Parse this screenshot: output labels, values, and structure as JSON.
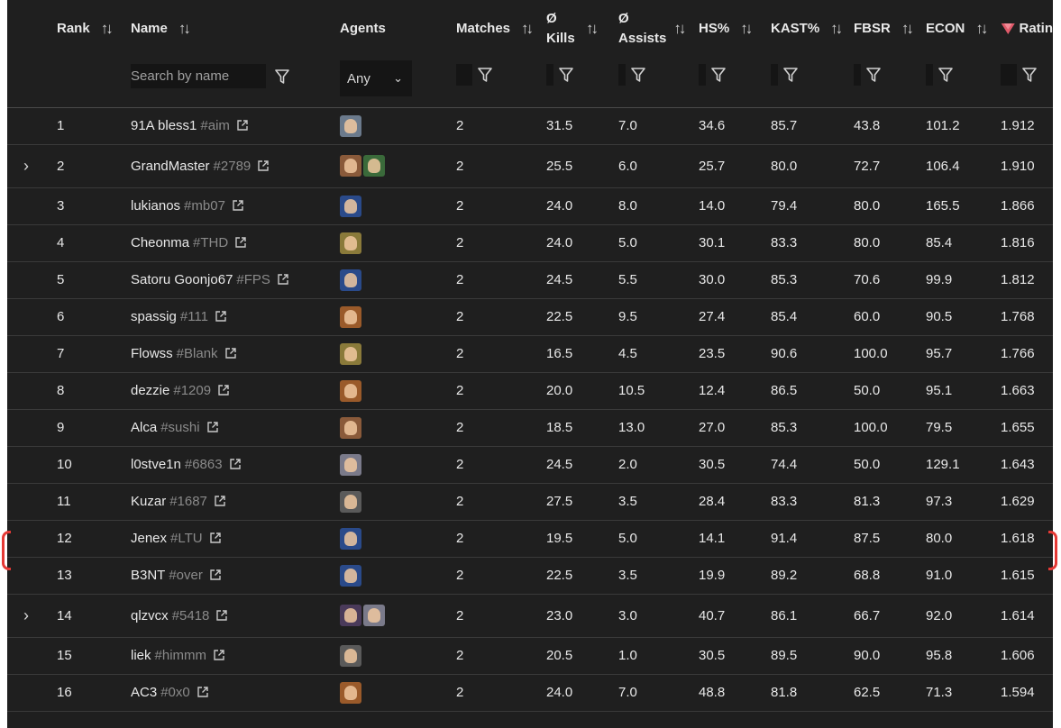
{
  "columns": {
    "rank": "Rank",
    "name": "Name",
    "agents": "Agents",
    "matches": "Matches",
    "kills_symbol": "Ø",
    "kills": "Kills",
    "assists_symbol": "Ø",
    "assists": "Assists",
    "hs": "HS%",
    "kast": "KAST%",
    "fbsr": "FBSR",
    "econ": "ECON",
    "rating": "Ratin"
  },
  "filters": {
    "search_placeholder": "Search by name",
    "agent_select": "Any"
  },
  "colors": {
    "background": "#1f1f1f",
    "text": "#e8e8e8",
    "tag": "#8a8a8a",
    "highlight_bracket": "#e53935",
    "rating_logo": "#e05a6a"
  },
  "rows": [
    {
      "rank": "1",
      "name": "91A bless1",
      "tag": "#aim",
      "agents": [
        "#6b7a8c"
      ],
      "matches": "2",
      "kills": "31.5",
      "assists": "7.0",
      "hs": "34.6",
      "kast": "85.7",
      "fbsr": "43.8",
      "econ": "101.2",
      "rating": "1.912",
      "expandable": false
    },
    {
      "rank": "2",
      "name": "GrandMaster",
      "tag": "#2789",
      "agents": [
        "#8a5a3a",
        "#3a6a3a"
      ],
      "matches": "2",
      "kills": "25.5",
      "assists": "6.0",
      "hs": "25.7",
      "kast": "80.0",
      "fbsr": "72.7",
      "econ": "106.4",
      "rating": "1.910",
      "expandable": true
    },
    {
      "rank": "3",
      "name": "lukianos",
      "tag": "#mb07",
      "agents": [
        "#2a4a8a"
      ],
      "matches": "2",
      "kills": "24.0",
      "assists": "8.0",
      "hs": "14.0",
      "kast": "79.4",
      "fbsr": "80.0",
      "econ": "165.5",
      "rating": "1.866",
      "expandable": false
    },
    {
      "rank": "4",
      "name": "Cheonma",
      "tag": "#THD",
      "agents": [
        "#8a7a3a"
      ],
      "matches": "2",
      "kills": "24.0",
      "assists": "5.0",
      "hs": "30.1",
      "kast": "83.3",
      "fbsr": "80.0",
      "econ": "85.4",
      "rating": "1.816",
      "expandable": false
    },
    {
      "rank": "5",
      "name": "Satoru Goonjo67",
      "tag": "#FPS",
      "agents": [
        "#2a4a8a"
      ],
      "matches": "2",
      "kills": "24.5",
      "assists": "5.5",
      "hs": "30.0",
      "kast": "85.3",
      "fbsr": "70.6",
      "econ": "99.9",
      "rating": "1.812",
      "expandable": false
    },
    {
      "rank": "6",
      "name": "spassig",
      "tag": "#111",
      "agents": [
        "#9a5a2a"
      ],
      "matches": "2",
      "kills": "22.5",
      "assists": "9.5",
      "hs": "27.4",
      "kast": "85.4",
      "fbsr": "60.0",
      "econ": "90.5",
      "rating": "1.768",
      "expandable": false
    },
    {
      "rank": "7",
      "name": "Flowss",
      "tag": "#Blank",
      "agents": [
        "#8a7a3a"
      ],
      "matches": "2",
      "kills": "16.5",
      "assists": "4.5",
      "hs": "23.5",
      "kast": "90.6",
      "fbsr": "100.0",
      "econ": "95.7",
      "rating": "1.766",
      "expandable": false
    },
    {
      "rank": "8",
      "name": "dezzie",
      "tag": "#1209",
      "agents": [
        "#9a5a2a"
      ],
      "matches": "2",
      "kills": "20.0",
      "assists": "10.5",
      "hs": "12.4",
      "kast": "86.5",
      "fbsr": "50.0",
      "econ": "95.1",
      "rating": "1.663",
      "expandable": false
    },
    {
      "rank": "9",
      "name": "Alca",
      "tag": "#sushi",
      "agents": [
        "#8a5a3a"
      ],
      "matches": "2",
      "kills": "18.5",
      "assists": "13.0",
      "hs": "27.0",
      "kast": "85.3",
      "fbsr": "100.0",
      "econ": "79.5",
      "rating": "1.655",
      "expandable": false
    },
    {
      "rank": "10",
      "name": "l0stve1n",
      "tag": "#6863",
      "agents": [
        "#7a7a8a"
      ],
      "matches": "2",
      "kills": "24.5",
      "assists": "2.0",
      "hs": "30.5",
      "kast": "74.4",
      "fbsr": "50.0",
      "econ": "129.1",
      "rating": "1.643",
      "expandable": false
    },
    {
      "rank": "11",
      "name": "Kuzar",
      "tag": "#1687",
      "agents": [
        "#5a5a5a"
      ],
      "matches": "2",
      "kills": "27.5",
      "assists": "3.5",
      "hs": "28.4",
      "kast": "83.3",
      "fbsr": "81.3",
      "econ": "97.3",
      "rating": "1.629",
      "expandable": false
    },
    {
      "rank": "12",
      "name": "Jenex",
      "tag": "#LTU",
      "agents": [
        "#2a4a8a"
      ],
      "matches": "2",
      "kills": "19.5",
      "assists": "5.0",
      "hs": "14.1",
      "kast": "91.4",
      "fbsr": "87.5",
      "econ": "80.0",
      "rating": "1.618",
      "expandable": false
    },
    {
      "rank": "13",
      "name": "B3NT",
      "tag": "#over",
      "agents": [
        "#2a4a8a"
      ],
      "matches": "2",
      "kills": "22.5",
      "assists": "3.5",
      "hs": "19.9",
      "kast": "89.2",
      "fbsr": "68.8",
      "econ": "91.0",
      "rating": "1.615",
      "expandable": false
    },
    {
      "rank": "14",
      "name": "qlzvcx",
      "tag": "#5418",
      "agents": [
        "#4a3a5a",
        "#7a7a8a"
      ],
      "matches": "2",
      "kills": "23.0",
      "assists": "3.0",
      "hs": "40.7",
      "kast": "86.1",
      "fbsr": "66.7",
      "econ": "92.0",
      "rating": "1.614",
      "expandable": true
    },
    {
      "rank": "15",
      "name": "liek",
      "tag": "#himmm",
      "agents": [
        "#5a5a5a"
      ],
      "matches": "2",
      "kills": "20.5",
      "assists": "1.0",
      "hs": "30.5",
      "kast": "89.5",
      "fbsr": "90.0",
      "econ": "95.8",
      "rating": "1.606",
      "expandable": false
    },
    {
      "rank": "16",
      "name": "AC3",
      "tag": "#0x0",
      "agents": [
        "#9a5a2a"
      ],
      "matches": "2",
      "kills": "24.0",
      "assists": "7.0",
      "hs": "48.8",
      "kast": "81.8",
      "fbsr": "62.5",
      "econ": "71.3",
      "rating": "1.594",
      "expandable": false
    }
  ]
}
